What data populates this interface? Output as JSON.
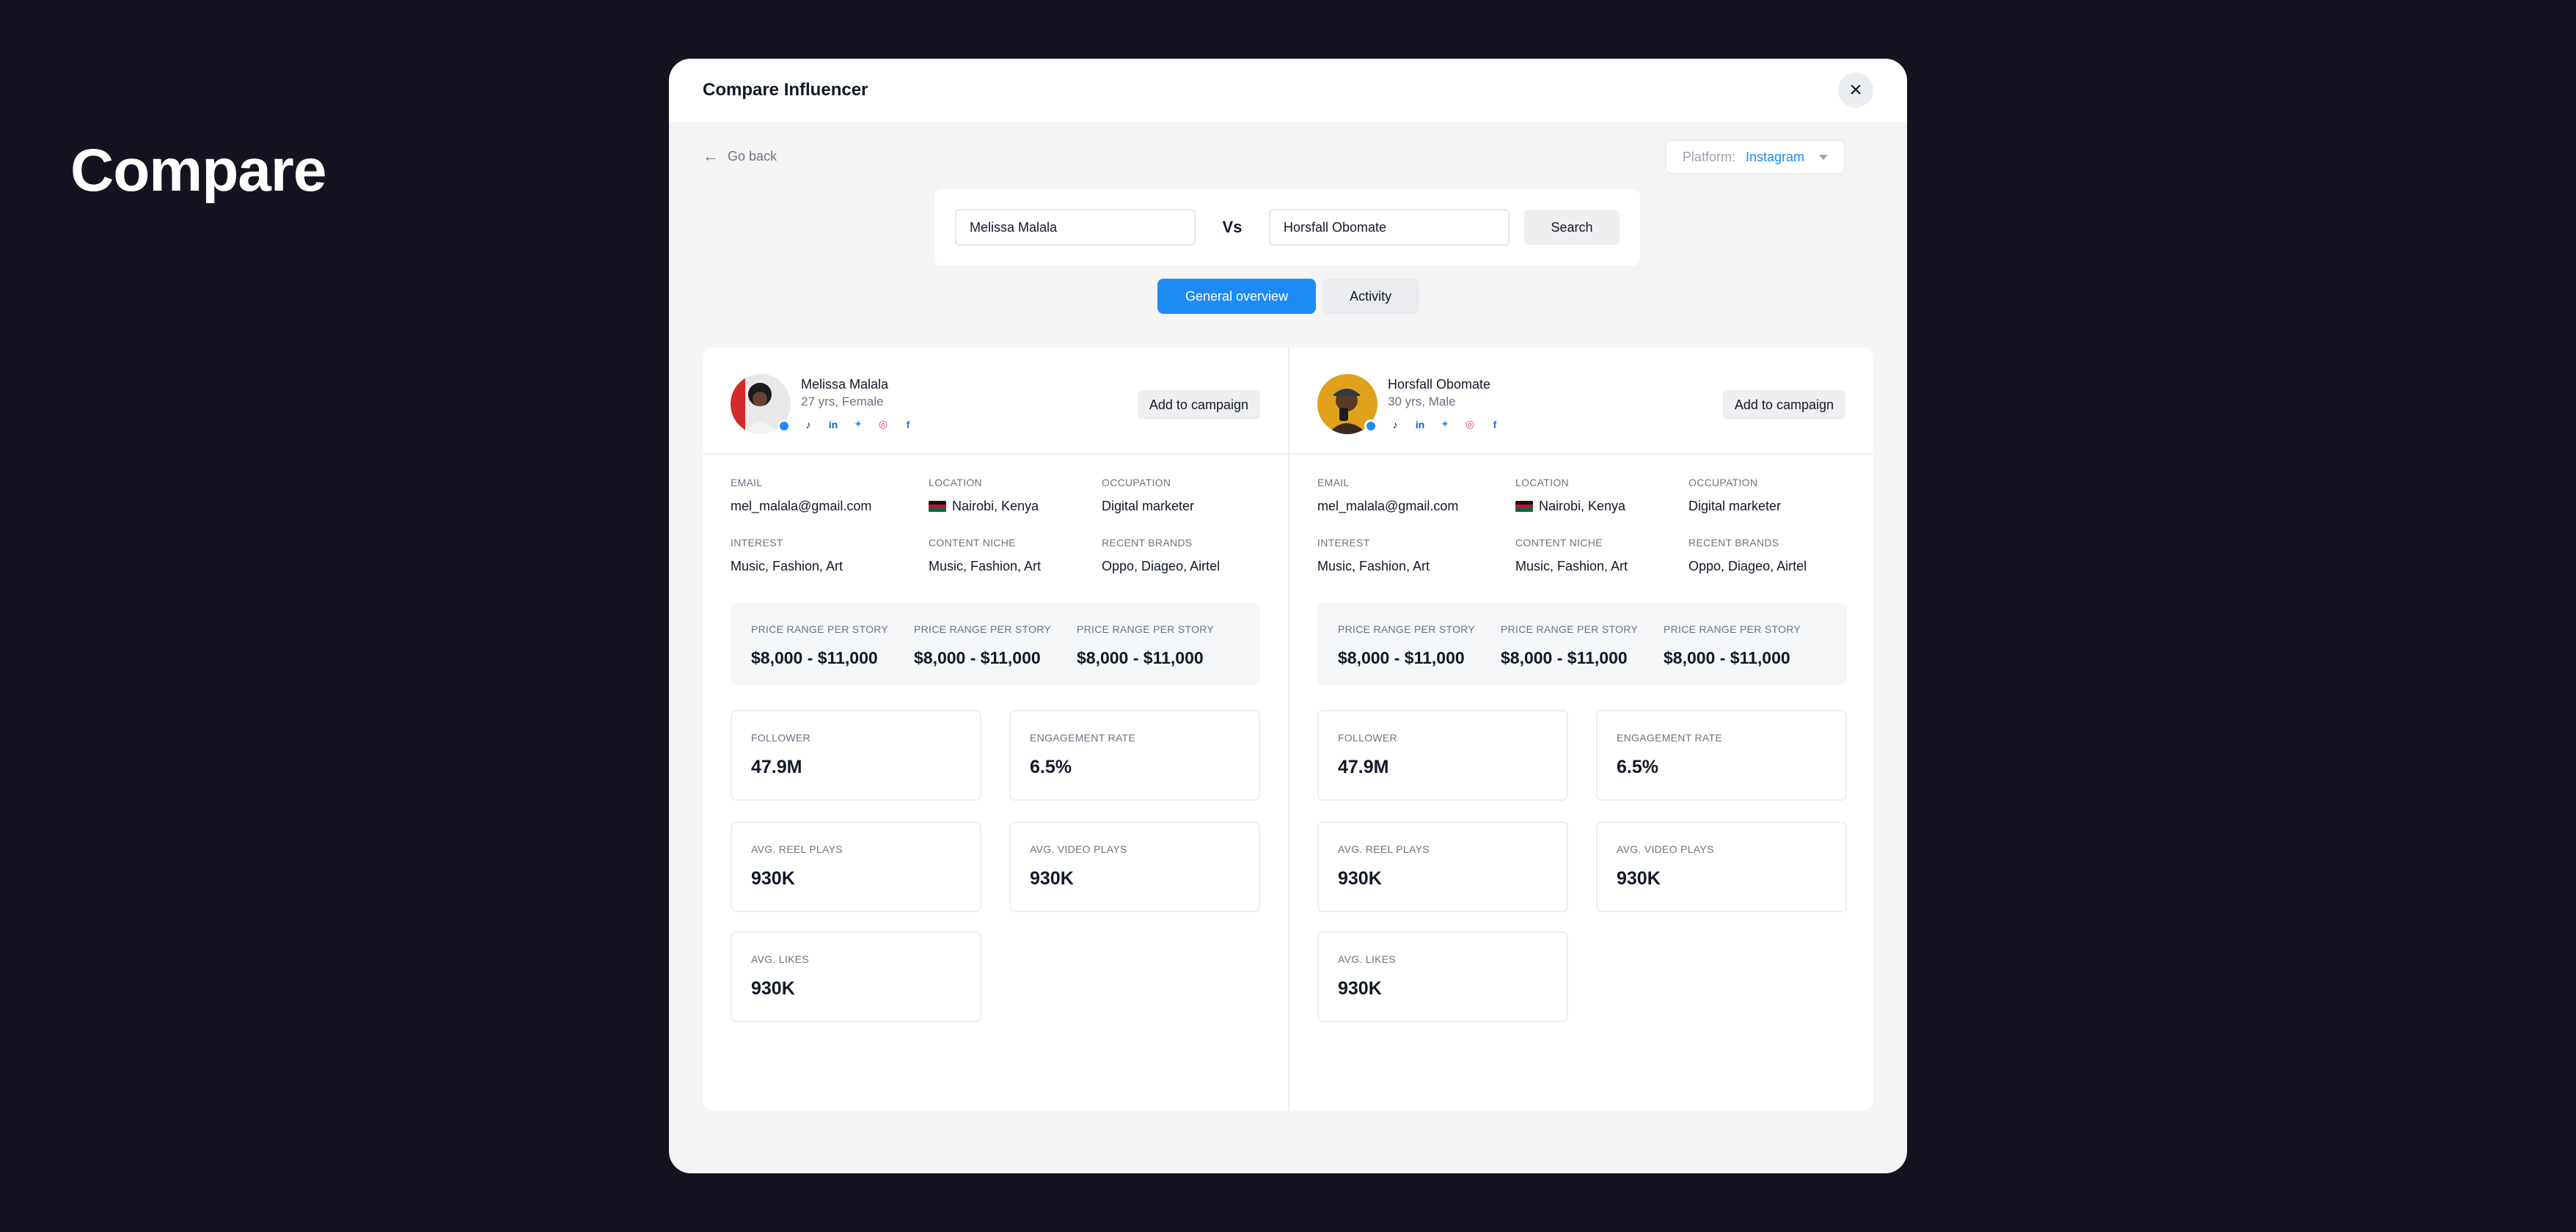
{
  "page_heading": "Compare",
  "modal": {
    "title": "Compare Influencer",
    "close_icon": "×",
    "go_back": "Go back",
    "platform": {
      "label": "Platform:",
      "value": "Instagram"
    }
  },
  "search": {
    "left_value": "Melissa Malala",
    "vs": "Vs",
    "right_value": "Horsfall Obomate",
    "button": "Search"
  },
  "tabs": [
    {
      "label": "General overview",
      "active": true
    },
    {
      "label": "Activity",
      "active": false
    }
  ],
  "labels": {
    "email": "EMAIL",
    "location": "LOCATION",
    "occupation": "OCCUPATION",
    "interest": "INTEREST",
    "content_niche": "CONTENT NICHE",
    "recent_brands": "RECENT BRANDS",
    "price_range": "PRICE RANGE PER STORY",
    "follower": "FOLLOWER",
    "engagement_rate": "ENGAGEMENT RATE",
    "avg_reel_plays": "AVG. REEL PLAYS",
    "avg_video_plays": "AVG. VIDEO PLAYS",
    "avg_likes": "AVG. LIKES",
    "add_to_campaign": "Add to campaign"
  },
  "socials": [
    {
      "icon": "tiktok-icon",
      "glyph": "♪",
      "color": "#111827"
    },
    {
      "icon": "linkedin-icon",
      "glyph": "in",
      "color": "#0a66c2"
    },
    {
      "icon": "twitter-icon",
      "glyph": "✦",
      "color": "#1d9bf0"
    },
    {
      "icon": "instagram-icon",
      "glyph": "◎",
      "color": "#e1306c"
    },
    {
      "icon": "facebook-icon",
      "glyph": "f",
      "color": "#1877f2"
    }
  ],
  "colors": {
    "accent": "#1e8bf5",
    "background": "#141420"
  },
  "influencers": [
    {
      "name": "Melissa Malala",
      "meta": "27 yrs, Female",
      "email": "mel_malala@gmail.com",
      "location": "Nairobi, Kenya",
      "occupation": "Digital marketer",
      "interest": "Music, Fashion, Art",
      "content_niche": "Music, Fashion, Art",
      "recent_brands": "Oppo, Diageo, Airtel",
      "prices": [
        "$8,000 - $11,000",
        "$8,000 - $11,000",
        "$8,000 - $11,000"
      ],
      "follower": "47.9M",
      "engagement_rate": "6.5%",
      "avg_reel_plays": "930K",
      "avg_video_plays": "930K",
      "avg_likes": "930K"
    },
    {
      "name": "Horsfall Obomate",
      "meta": "30 yrs, Male",
      "email": "mel_malala@gmail.com",
      "location": "Nairobi, Kenya",
      "occupation": "Digital marketer",
      "interest": "Music, Fashion, Art",
      "content_niche": "Music, Fashion, Art",
      "recent_brands": "Oppo, Diageo, Airtel",
      "prices": [
        "$8,000 - $11,000",
        "$8,000 - $11,000",
        "$8,000 - $11,000"
      ],
      "follower": "47.9M",
      "engagement_rate": "6.5%",
      "avg_reel_plays": "930K",
      "avg_video_plays": "930K",
      "avg_likes": "930K"
    }
  ]
}
